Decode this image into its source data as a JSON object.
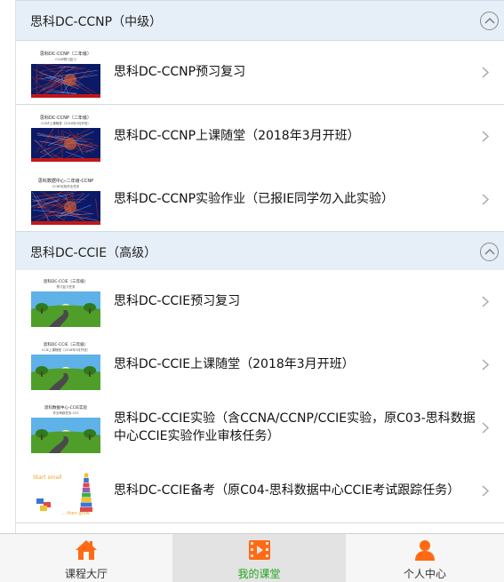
{
  "colors": {
    "accent_orange": "#ff6a13",
    "active_tab_text": "#1fa51f",
    "section_header_bg": "#e6eff7"
  },
  "sections": [
    {
      "title": "思科DC-CCNP（中级）",
      "collapse_icon": "chevron-up-circle-icon",
      "items": [
        {
          "label": "思科DC-CCNP预习复习",
          "thumb": {
            "caption": "思科DC-CCNP（二年级）",
            "subcaption": "CCNP预习复习",
            "style": "network-red"
          }
        },
        {
          "label": "思科DC-CCNP上课随堂（2018年3月开班）",
          "thumb": {
            "caption": "思科DC-CCNP（二年级）",
            "subcaption": "CCNP上课随堂（2018年3月开班）",
            "style": "network-red"
          }
        },
        {
          "label": "思科DC-CCNP实验作业（已报IE同学勿入此实验）",
          "thumb": {
            "caption": "思科数据中心-二年级-CCNP",
            "subcaption": "CCNP实验作业任务",
            "style": "network-red"
          }
        }
      ]
    },
    {
      "title": "思科DC-CCIE（高级）",
      "collapse_icon": "chevron-up-circle-icon",
      "items": [
        {
          "label": "思科DC-CCIE预习复习",
          "thumb": {
            "caption": "思科DC-CCIE（三年级）",
            "subcaption": "预习复习任务",
            "style": "landscape-road"
          }
        },
        {
          "label": "思科DC-CCIE上课随堂（2018年3月开班）",
          "thumb": {
            "caption": "思科DC-CCIE（三年级）",
            "subcaption": "CCIE上课随堂（2018年3月开班）",
            "style": "landscape-road"
          }
        },
        {
          "label": "思科DC-CCIE实验（含CCNA/CCNP/CCIE实验，原C03-思科数据中心CCIE实验作业审核任务）",
          "thumb": {
            "caption": "思科数据中心-CCIE实验",
            "subcaption": "作业审核任务-C03",
            "style": "landscape-road"
          }
        },
        {
          "label": "思科DC-CCIE备考（原C04-思科数据中心CCIE考试跟踪任务）",
          "thumb": {
            "caption": "Start small",
            "subcaption": "... then grow",
            "style": "blocks"
          }
        }
      ]
    }
  ],
  "tabs": [
    {
      "label": "课程大厅",
      "icon": "home-icon",
      "active": false
    },
    {
      "label": "我的课堂",
      "icon": "film-icon",
      "active": true
    },
    {
      "label": "个人中心",
      "icon": "person-icon",
      "active": false
    }
  ]
}
